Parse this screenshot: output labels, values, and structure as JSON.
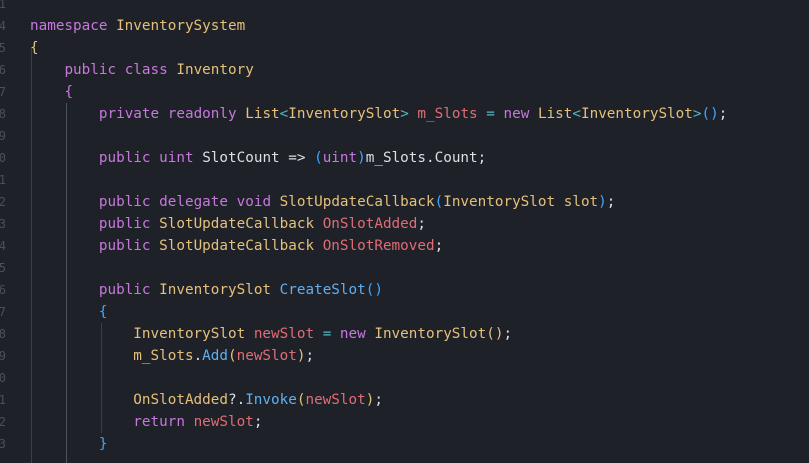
{
  "gutter": {
    "line_numbers": [
      "1",
      "4",
      "5",
      "6",
      "7",
      "8",
      "9",
      "0",
      "1",
      "2",
      "3",
      "4",
      "5",
      "6",
      "7",
      "8",
      "9",
      "0",
      "1",
      "2",
      "3"
    ]
  },
  "code": {
    "l1": {
      "kw": "namespace",
      "name": "InventorySystem"
    },
    "l2": {
      "brace": "{"
    },
    "l3": {
      "kw1": "public",
      "kw2": "class",
      "name": "Inventory"
    },
    "l4": {
      "brace": "{"
    },
    "l5": {
      "kw1": "private",
      "kw2": "readonly",
      "t1": "List",
      "lt1": "<",
      "t2": "InventorySlot",
      "gt1": ">",
      "field": "m_Slots",
      "eq": "=",
      "kw3": "new",
      "t3": "List",
      "lt2": "<",
      "t4": "InventorySlot",
      "gt2": ">",
      "parens": "()",
      "semi": ";"
    },
    "l6": {
      "kw1": "public",
      "kw2": "uint",
      "name": "SlotCount",
      "arrow": "=>",
      "po": "(",
      "cast": "uint",
      "pc": ")",
      "tail": "m_Slots.Count;"
    },
    "l7": {
      "kw1": "public",
      "kw2": "delegate",
      "kw3": "void",
      "name": "SlotUpdateCallback",
      "po": "(",
      "ptype": "InventorySlot",
      "pname": "slot",
      "pc": ")",
      "semi": ";"
    },
    "l8": {
      "kw1": "public",
      "type": "SlotUpdateCallback",
      "field": "OnSlotAdded",
      "semi": ";"
    },
    "l9": {
      "kw1": "public",
      "type": "SlotUpdateCallback",
      "field": "OnSlotRemoved",
      "semi": ";"
    },
    "l10": {
      "kw1": "public",
      "type": "InventorySlot",
      "fn": "CreateSlot",
      "parens": "()"
    },
    "l11": {
      "brace": "{"
    },
    "l12": {
      "type": "InventorySlot",
      "local": "newSlot",
      "eq": "=",
      "kw": "new",
      "ctor": "InventorySlot",
      "parens": "()",
      "semi": ";"
    },
    "l13": {
      "obj": "m_Slots",
      "dot": ".",
      "fn": "Add",
      "po": "(",
      "arg": "newSlot",
      "pc": ")",
      "semi": ";"
    },
    "l14": {
      "obj": "OnSlotAdded",
      "q": "?.",
      "fn": "Invoke",
      "po": "(",
      "arg": "newSlot",
      "pc": ")",
      "semi": ";"
    },
    "l15": {
      "kw": "return",
      "local": "newSlot",
      "semi": ";"
    },
    "l16": {
      "brace": "}"
    }
  }
}
